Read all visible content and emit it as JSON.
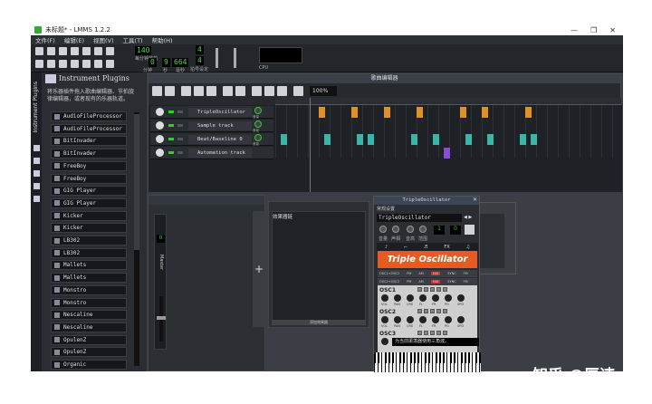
{
  "window": {
    "title": "未标题* - LMMS 1.2.2",
    "controls": [
      "—",
      "❐",
      "✕"
    ]
  },
  "menu": [
    "文件(F)",
    "编辑(E)",
    "视图(V)",
    "工具(T)",
    "帮助(H)"
  ],
  "toolbar": {
    "tempo_value": "140",
    "tempo_label": "每分钟节拍",
    "time_min": "0",
    "time_sec": "9",
    "time_ms": "664",
    "min_label": "分钟",
    "sec_label": "秒",
    "ms_label": "毫秒",
    "timesig_num": "4",
    "timesig_den": "4",
    "timesig_label": "拍号设定",
    "cpu_label": "CPU"
  },
  "sidebar": {
    "title": "Instrument Plugins",
    "vertical_label": "Instrument Plugins"
  },
  "browser": {
    "title": "Instrument Plugins",
    "description": "将乐器插件拖入歌曲编辑器、节拍旋律编辑器，或者现有的乐器轨道。",
    "plugins": [
      "AudioFileProcessor",
      "AudioFileProcessor",
      "BitInvader",
      "BitInvader",
      "FreeBoy",
      "FreeBoy",
      "GIG Player",
      "GIG Player",
      "Kicker",
      "Kicker",
      "LB302",
      "LB302",
      "Mallets",
      "Mallets",
      "Monstro",
      "Monstro",
      "Nescaline",
      "Nescaline",
      "OpulenZ",
      "OpulenZ",
      "Organic"
    ]
  },
  "song_editor": {
    "title": "歌曲编辑器",
    "zoom": "100%",
    "tracks": [
      {
        "name": "TripleOscillator"
      },
      {
        "name": "Sample track"
      },
      {
        "name": "Beat/Baseline 0"
      },
      {
        "name": "Automation track"
      }
    ],
    "knob_label": "音量"
  },
  "mixer": {
    "channel_name": "Master",
    "channel_number": "0",
    "add_symbol": "+"
  },
  "fx_chain": {
    "label": "效果器链",
    "add_button": "添加效果器"
  },
  "instrument_window": {
    "title": "TripleOscillator",
    "general_settings": "常规设置",
    "track_name": "TripleOscillator",
    "banner": "Triple Oscillator",
    "osc_labels": [
      "OSC1",
      "OSC2",
      "OSC3"
    ],
    "knob_labels": [
      "VOL",
      "PAN",
      "CRS",
      "FL",
      "FR",
      "PO",
      "SPD"
    ],
    "tab_icons": [
      "♪",
      "⌐",
      "♬",
      "FX",
      "♫"
    ],
    "tooltip": "为当前振荡器使用三角波。",
    "mod_row1": [
      "OSC1+OSC2",
      "PM",
      "AM",
      "MIX",
      "SYNC",
      "FM"
    ],
    "mod_row2": [
      "OSC2+OSC3",
      "PM",
      "AM",
      "MIX",
      "SYNC",
      "FM"
    ],
    "ctrl_labels": [
      "音量",
      "声相",
      "音高",
      "范围"
    ]
  },
  "watermark": "知乎 @厘谏",
  "colors": {
    "accent": "#e85a1f",
    "pattern_orange": "#e0902a",
    "pattern_teal": "#3ab5a8",
    "pattern_purple": "#8a4bd8",
    "lcd_green": "#43e04a"
  }
}
